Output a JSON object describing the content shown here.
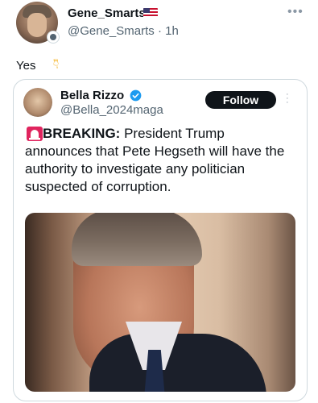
{
  "outer_tweet": {
    "author_name": "Gene_Smarts",
    "author_handle": "@Gene_Smarts",
    "time_separator": " · ",
    "time": "1h",
    "text": "Yes",
    "flag_icon": "us-flag-icon",
    "reaction_icon": "pointing-down-icon"
  },
  "quoted_tweet": {
    "author_name": "Bella Rizzo",
    "author_handle": "@Bella_2024maga",
    "follow_label": "Follow",
    "breaking_label": "BREAKING:",
    "body": " President Trump announces that Pete Hegseth will have the authority to investigate any politician suspected of corruption.",
    "verified_color": "#1d9bf0",
    "siren_icon": "siren-icon"
  }
}
